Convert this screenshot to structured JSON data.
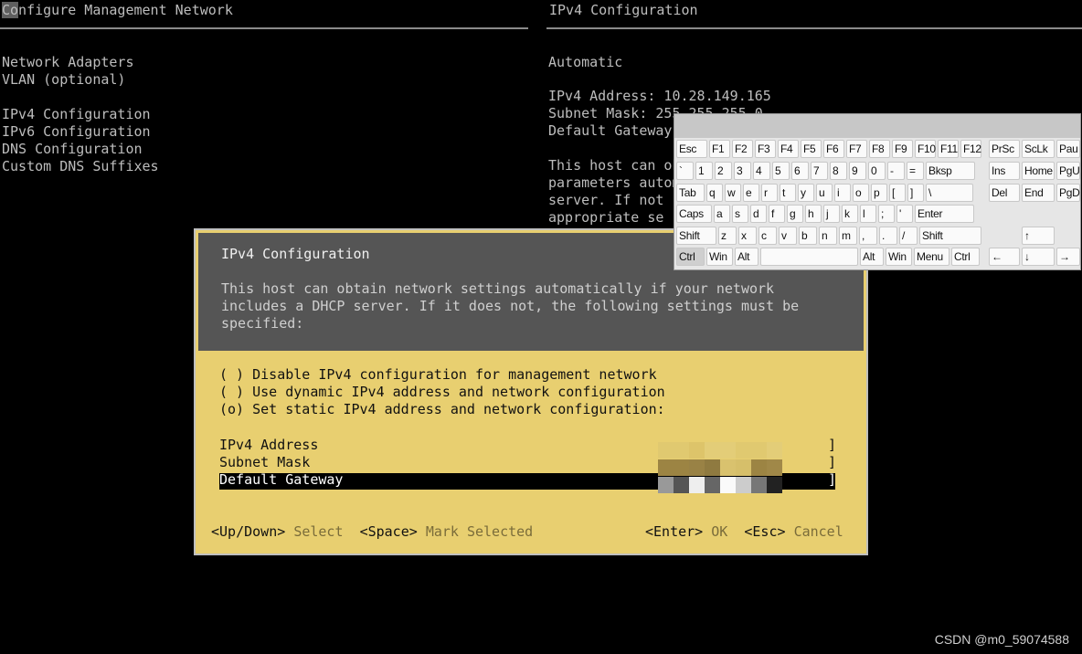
{
  "left_panel": {
    "title": "Configure Management Network",
    "items": [
      "Network Adapters",
      "VLAN (optional)",
      "",
      "IPv4 Configuration",
      "IPv6 Configuration",
      "DNS Configuration",
      "Custom DNS Suffixes"
    ]
  },
  "right_panel": {
    "title": "IPv4 Configuration",
    "mode": "Automatic",
    "lines": [
      "IPv4 Address: 10.28.149.165",
      "Subnet Mask: 255.255.255.0",
      "Default Gateway"
    ],
    "desc": [
      "This host can obtain network",
      "parameters automatically",
      "server. If not",
      "appropriate se"
    ]
  },
  "dialog": {
    "title": "IPv4 Configuration",
    "desc": [
      "This host can obtain network settings automatically if your network",
      "includes a DHCP server. If it does not, the following settings must be",
      "specified:"
    ],
    "options": [
      "( ) Disable IPv4 configuration for management network",
      "( ) Use dynamic IPv4 address and network configuration",
      "(o) Set static IPv4 address and network configuration:"
    ],
    "selected_option": 2,
    "fields": [
      {
        "label": "IPv4 Address",
        "value": "]"
      },
      {
        "label": "Subnet Mask",
        "value": "]"
      },
      {
        "label": "Default Gateway",
        "value": "]"
      }
    ],
    "selected_field": 2,
    "footer": {
      "k1": "<Up/Down>",
      "a1": "Select",
      "k2": "<Space>",
      "a2": "Mark Selected",
      "k3": "<Enter>",
      "a3": "OK",
      "k4": "<Esc>",
      "a4": "Cancel"
    },
    "colors": {
      "background": "#e8cf70",
      "header": "#555555",
      "selection": "#000000"
    }
  },
  "keyboard": {
    "main": [
      [
        "Esc",
        "F1",
        "F2",
        "F3",
        "F4",
        "F5",
        "F6",
        "F7",
        "F8",
        "F9",
        "F10",
        "F11",
        "F12"
      ],
      [
        "`",
        "1",
        "2",
        "3",
        "4",
        "5",
        "6",
        "7",
        "8",
        "9",
        "0",
        "-",
        "=",
        "Bksp"
      ],
      [
        "Tab",
        "q",
        "w",
        "e",
        "r",
        "t",
        "y",
        "u",
        "i",
        "o",
        "p",
        "[",
        "]",
        "\\"
      ],
      [
        "Caps",
        "a",
        "s",
        "d",
        "f",
        "g",
        "h",
        "j",
        "k",
        "l",
        ";",
        "'",
        "Enter"
      ],
      [
        "Shift",
        "z",
        "x",
        "c",
        "v",
        "b",
        "n",
        "m",
        ",",
        ".",
        "/",
        "Shift"
      ],
      [
        "Ctrl",
        "Win",
        "Alt",
        "",
        "Alt",
        "Win",
        "Menu",
        "Ctrl"
      ]
    ],
    "nav": [
      [
        "PrSc",
        "ScLk",
        "Pau"
      ],
      [
        "Ins",
        "Home",
        "PgU"
      ],
      [
        "Del",
        "End",
        "PgD"
      ],
      [],
      [
        "",
        "↑",
        ""
      ],
      [
        "←",
        "↓",
        "→"
      ]
    ],
    "pressed": [
      "Ctrl"
    ]
  },
  "watermark": "CSDN @m0_59074588"
}
